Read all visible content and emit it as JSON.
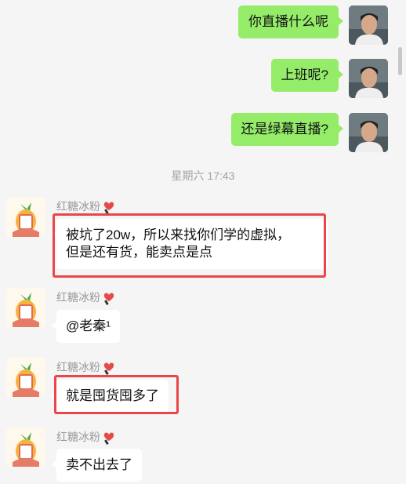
{
  "chat": {
    "outgoing": [
      {
        "text": "你直播什么呢"
      },
      {
        "text": "上班呢?"
      },
      {
        "text": "还是绿幕直播?"
      }
    ],
    "timestamp": "星期六 17:43",
    "incoming": [
      {
        "sender": "红糖冰粉",
        "lines": [
          "被坑了20w，所以来找你们学的虚拟，",
          "但是还有货，能卖点是点"
        ]
      },
      {
        "sender": "红糖冰粉",
        "lines": [
          "@老秦¹"
        ]
      },
      {
        "sender": "红糖冰粉",
        "lines": [
          "就是囤货囤多了"
        ]
      },
      {
        "sender": "红糖冰粉",
        "lines": [
          "卖不出去了"
        ]
      }
    ]
  },
  "colors": {
    "outgoing_bubble": "#95ec69",
    "incoming_bubble": "#ffffff",
    "highlight": "#e9454a"
  },
  "icons": {
    "sender_badge": "heart-brush-badge-icon"
  }
}
